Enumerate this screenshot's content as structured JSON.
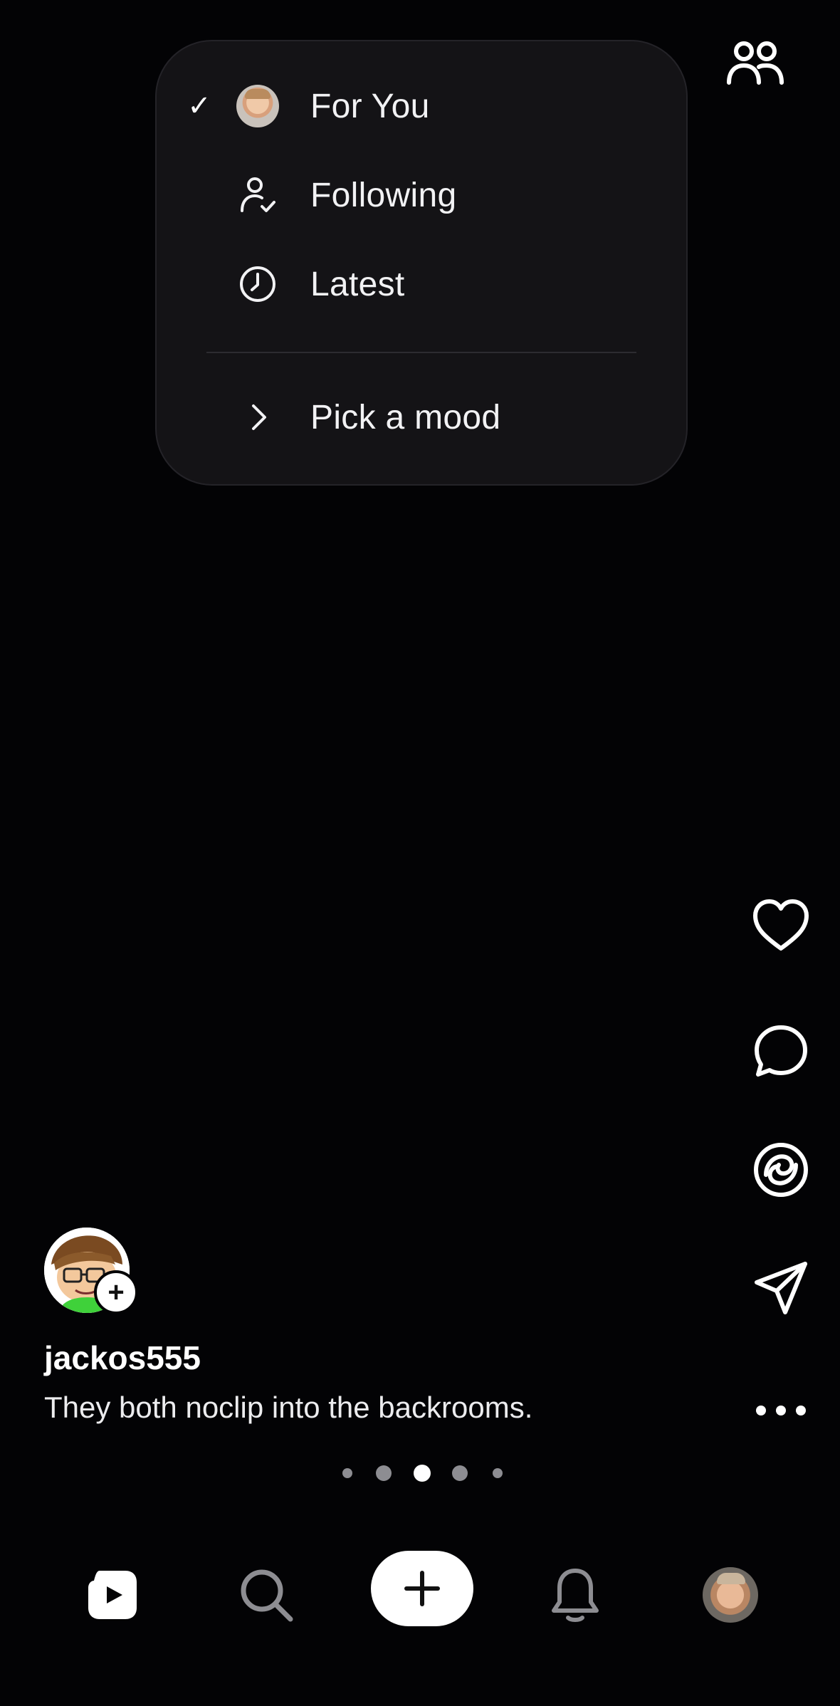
{
  "menu": {
    "items": [
      {
        "label": "For You",
        "selected": true,
        "icon": "avatar-icon"
      },
      {
        "label": "Following",
        "selected": false,
        "icon": "person-check-icon"
      },
      {
        "label": "Latest",
        "selected": false,
        "icon": "clock-icon"
      }
    ],
    "mood": {
      "label": "Pick a mood",
      "icon": "chevron-right-icon"
    },
    "check_glyph": "✓"
  },
  "post": {
    "username": "jackos555",
    "caption": "They both noclip into the backrooms.",
    "follow_glyph": "+"
  },
  "rail": [
    "heart-icon",
    "comment-icon",
    "remix-icon",
    "send-icon",
    "more-icon"
  ],
  "pager": {
    "count": 5,
    "active_index": 2
  },
  "nav": [
    "reels-icon",
    "search-icon",
    "create-icon",
    "bell-icon",
    "profile-avatar"
  ],
  "colors": {
    "background": "#030305",
    "menu_bg": "#141316",
    "text": "#f2f2f4",
    "inactive_icon": "#8d8d92"
  }
}
